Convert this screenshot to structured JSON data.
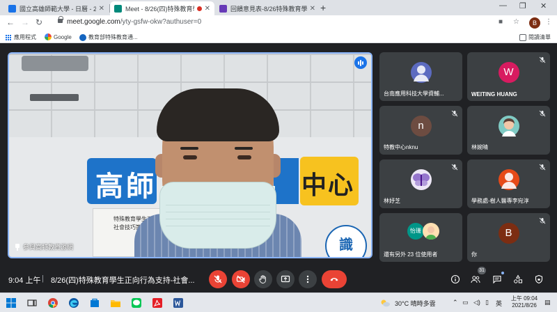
{
  "browser": {
    "tabs": [
      {
        "title": "國立高雄師範大學 - 日曆 - 2021年...",
        "favicon_color": "#1a73e8",
        "active": false
      },
      {
        "title": "Meet - 8/26(四)特殊教育學...",
        "favicon_color": "#00897b",
        "active": true
      },
      {
        "title": "回饋意見表-8/26特殊教育學生...",
        "favicon_color": "#673ab7",
        "active": false
      }
    ],
    "new_tab": "+",
    "url_host": "meet.google.com",
    "url_path": "/yty-gsfw-okw?authuser=0",
    "profile_initial": "B",
    "bookmarks": [
      {
        "label": "應用程式",
        "icon": "apps-icon"
      },
      {
        "label": "Google",
        "icon": "google-icon"
      },
      {
        "label": "教育部特殊教育通...",
        "icon": "moe-icon"
      }
    ],
    "reading_list": "閱讀清單"
  },
  "meet": {
    "main_participant": {
      "name": "參與高特教資源網",
      "speaking": true,
      "banner_chars": [
        "高",
        "師",
        "中",
        "心"
      ],
      "poster_lines": [
        "特殊教育學生正",
        "社會技巧策略與應"
      ],
      "badge_char": "識"
    },
    "participants": [
      {
        "name": "台南應用科技大學資輔...",
        "initial": "",
        "avatar_color": "#5c6bc0",
        "avatar_type": "person",
        "muted": false
      },
      {
        "name": "WEITING HUANG",
        "initial": "W",
        "avatar_color": "#d81b60",
        "avatar_type": "letter",
        "muted": true
      },
      {
        "name": "特教中心nknu",
        "initial": "n",
        "avatar_color": "#6d4c41",
        "avatar_type": "letter",
        "muted": true
      },
      {
        "name": "林婉晴",
        "initial": "",
        "avatar_color": "#80cbc4",
        "avatar_type": "photo",
        "muted": true
      },
      {
        "name": "林妤芝",
        "initial": "",
        "avatar_color": "#b39ddb",
        "avatar_type": "butterfly",
        "muted": true
      },
      {
        "name": "學務處-樹人醫專李宛淳",
        "initial": "",
        "avatar_color": "#e64a19",
        "avatar_type": "person",
        "muted": true
      },
      {
        "name": "還有另外 23 位使用者",
        "initial": "怡珊",
        "avatar_color": "#009688",
        "avatar_type": "group",
        "muted": false
      },
      {
        "name": "你",
        "initial": "B",
        "avatar_color": "#7c2d12",
        "avatar_type": "letter",
        "muted": true
      }
    ],
    "bottom": {
      "time": "9:04 上午",
      "separator": "|",
      "meeting_title": "8/26(四)特殊教育學生正向行為支持-社會...",
      "participant_count": "31"
    }
  },
  "taskbar": {
    "weather": "30°C  晴時多雲",
    "ime": "英",
    "clock_time": "上午 09:04",
    "clock_date": "2021/8/26"
  },
  "colors": {
    "meet_bg": "#202124",
    "tile_bg": "#3c4043",
    "red": "#ea4335",
    "accent": "#8ab4f8"
  }
}
